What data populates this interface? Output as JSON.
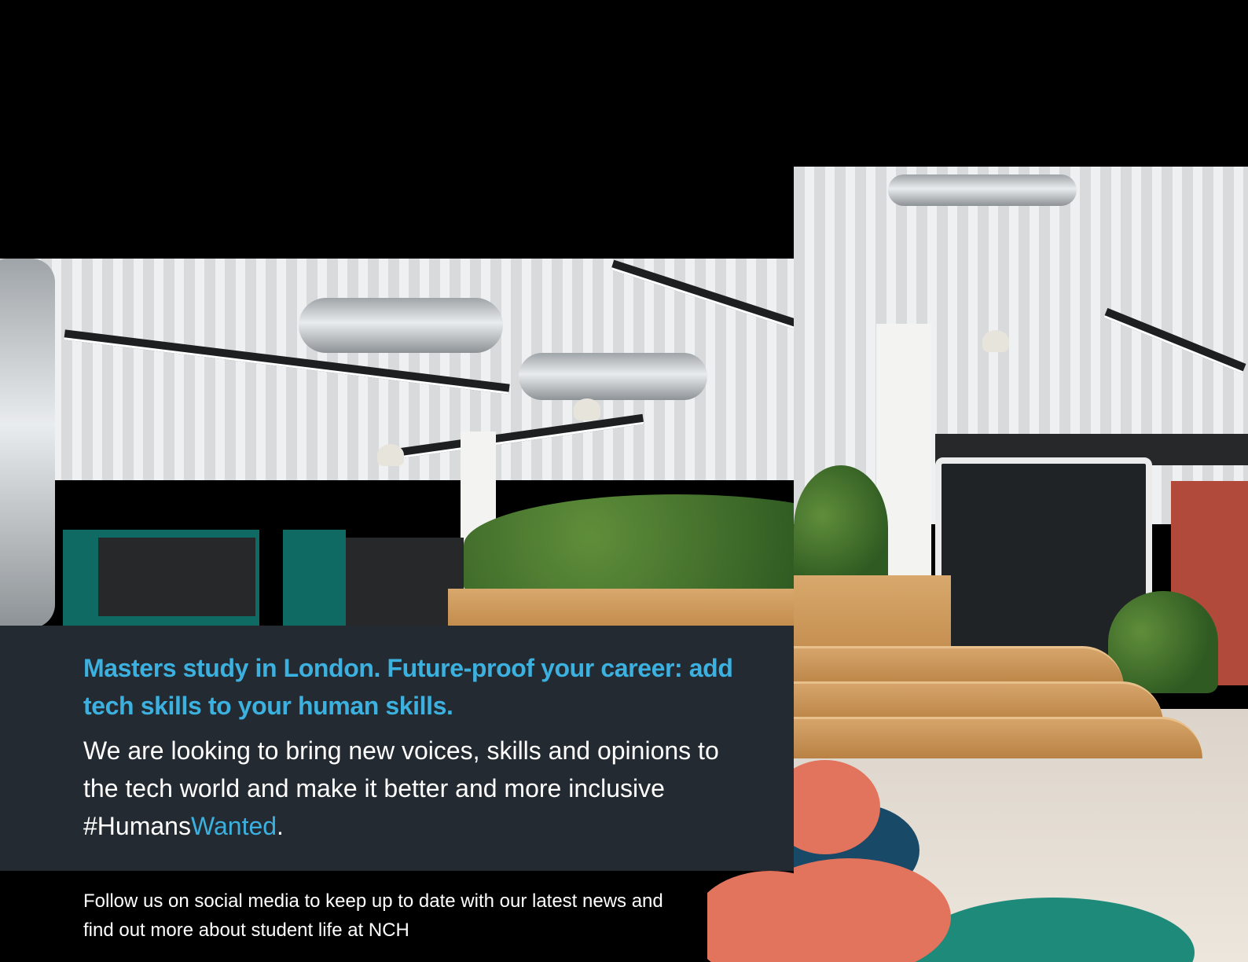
{
  "hero": {
    "image_alt": "Open-plan study space with exposed ducts, plants, wooden steps and orange poufs"
  },
  "panel": {
    "headline": "Masters study in London. Future-proof your career: add tech skills to your human skills.",
    "body_prefix": "We are looking to bring new voices, skills and opinions to the tech world and make it better and more inclusive #Humans",
    "body_highlight": "Wanted",
    "body_suffix": "."
  },
  "footer": {
    "social_text": "Follow us on social media to keep up to date with our latest news and find out more about student life at NCH"
  },
  "colors": {
    "accent": "#3cb1df",
    "panel_bg": "#232a31",
    "page_bg": "#000000"
  }
}
